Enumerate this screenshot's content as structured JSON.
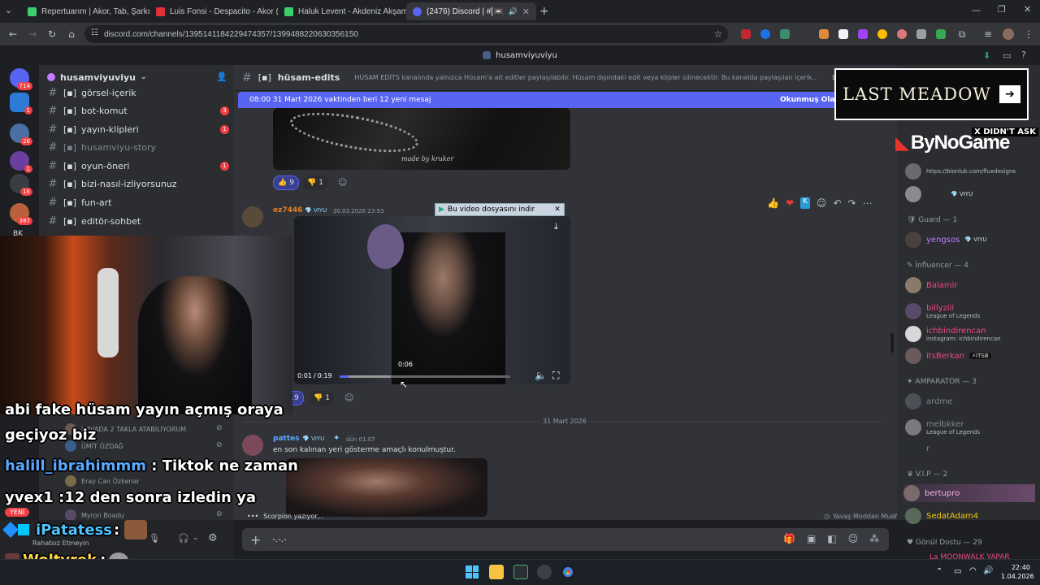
{
  "browser": {
    "tabs": [
      {
        "title": "Repertuarım | Akor, Tab, Şarkı S",
        "color": "#3ccf6e"
      },
      {
        "title": "Luis Fonsi - Despacito - Akor (",
        "color": "#e0303a"
      },
      {
        "title": "Haluk Levent - Akdeniz Akşaml",
        "color": "#3ccf6e"
      },
      {
        "title": "(2476) Discord | #[📼]hüsa",
        "color": "#5865f2"
      }
    ],
    "url": "discord.com/channels/1395141184229474357/1399488220630356150"
  },
  "discord": {
    "window_title": "husamviyuviyu",
    "server_name": "husamviyuviyu",
    "server_badges": [
      "714",
      "1",
      "26",
      "1",
      "8",
      "16",
      "387"
    ],
    "server_short": "BK",
    "channels": [
      {
        "name": "görsel-içerik",
        "badge": ""
      },
      {
        "name": "bot-komut",
        "badge": "3"
      },
      {
        "name": "yayın-klipleri",
        "badge": "1"
      },
      {
        "name": "husamviyu-story",
        "badge": ""
      },
      {
        "name": "oyun-öneri",
        "badge": "1"
      },
      {
        "name": "bizi-nasıl-izliyorsunuz",
        "badge": ""
      },
      {
        "name": "fun-art",
        "badge": ""
      },
      {
        "name": "editör-sohbet",
        "badge": ""
      }
    ],
    "channel_header": {
      "name": "hüsam-edits",
      "topic": "HÜSAM EDİTS kanalında yalnızca Hüsam'a ait editler paylaşılabilir. Hüsam dışındaki edit veya klipler silinecektir. Bu kanalda paylaşılan içerik..."
    },
    "new_messages_bar": {
      "text": "08:00 31 Mart 2026 vaktinden beri 12 yeni mesaj",
      "action": "Okunmuş Olarak"
    },
    "messages": [
      {
        "watermark": "made by kruker",
        "reactions": [
          {
            "emoji": "👍",
            "count": "9"
          },
          {
            "emoji": "👎",
            "count": "1"
          }
        ]
      },
      {
        "author": "ez7446",
        "role": "VIYU",
        "time": "30.03.2026 23:53",
        "download_tooltip": "Bu video dosyasını indir",
        "video": {
          "current": "0:01",
          "total": "0:19",
          "hover_time": "0:06",
          "progress": 0.05,
          "hover": 0.3
        },
        "reactions": [
          {
            "emoji": "👍",
            "count": "19"
          },
          {
            "emoji": "👎",
            "count": "1"
          }
        ]
      },
      {
        "date_divider": "31 Mart 2026"
      },
      {
        "author": "pattes",
        "role": "VIYU",
        "time": "dün 01:07",
        "text": "en son kalınan yeri gösterme amaçlı konulmuştur."
      }
    ],
    "typing": "Scorpion yazıyor...",
    "slowmode": "Yavaş Moddan Muaf",
    "composer_value": "-.-.-",
    "voice_users": [
      {
        "name": "HAVADA 2 TAKLA ATABİLİYORUM"
      },
      {
        "name": "ÜMİT ÖZDAĞ"
      },
      {
        "name": "Eray Can Özkenar"
      },
      {
        "name": "Myron Boadu"
      }
    ],
    "user_status": "Rahatsız Etmeyin",
    "new_label": "YENİ",
    "members": [
      {
        "group": ""
      },
      {
        "name": "",
        "sub": "https://bionluk.com/fluxdesigns",
        "color": "#b5bac1"
      },
      {
        "name": "",
        "badge": "VIYU",
        "color": "#b5bac1"
      },
      {
        "group": "Guard — 1"
      },
      {
        "name": "yengsos",
        "badge": "VIYU",
        "color": "#c37cff"
      },
      {
        "group": "İnfluencer — 4"
      },
      {
        "name": "Balamir",
        "color": "#f04787"
      },
      {
        "name": "billyziii",
        "sub": "League of Legends",
        "color": "#f04787"
      },
      {
        "name": "ichbindirencan",
        "sub": "instagram: ichbindirencan",
        "color": "#f04787"
      },
      {
        "name": "itsBerkan",
        "badge": "ITSB",
        "color": "#f04787"
      },
      {
        "group": "AMPARATOR — 3"
      },
      {
        "name": "ardme",
        "color": "#b5bac1"
      },
      {
        "name": "melbkker",
        "sub": "League of Legends",
        "color": "#b5bac1"
      },
      {
        "name": "r",
        "color": "#b5bac1"
      },
      {
        "group": "V.I.P — 2"
      },
      {
        "name": "bertupro",
        "color": "#f7b0e8"
      },
      {
        "name": "SedatAdam4",
        "color": "#f1c40f"
      },
      {
        "group": "Gönül Dostu — 29"
      },
      {
        "name": "La MOONWALK YAPAR",
        "color": "#f04787"
      }
    ]
  },
  "overlay": {
    "ad_title": "LAST MEADOW",
    "ad_subtitle": "X DIDN'T ASK",
    "brand": "ByNoGame",
    "chat": [
      {
        "user": "",
        "text": "abi fake hüsam yayın açmış oraya"
      },
      {
        "user": "",
        "text": "geçiyoz biz"
      },
      {
        "user": "halill_ibrahimmm",
        "text": " : Tiktok ne zaman"
      },
      {
        "user": "yvex1",
        "text": " :12 den sonra izledin ya"
      },
      {
        "user": "iPatatess",
        "text": " :"
      },
      {
        "user": "Woltyrek",
        "text": " :"
      }
    ]
  },
  "taskbar": {
    "time": "22:40",
    "date": "1.04.2026"
  },
  "icons": [
    "back-icon",
    "forward-icon",
    "reload-icon",
    "home-icon",
    "star-icon",
    "menu-icon",
    "hash-icon",
    "plus-icon",
    "gift-icon",
    "emoji-icon",
    "mic-icon",
    "headphones-icon",
    "settings-icon",
    "volume-icon",
    "fullscreen-icon",
    "download-icon",
    "windows-icon",
    "folder-icon",
    "chrome-icon"
  ]
}
